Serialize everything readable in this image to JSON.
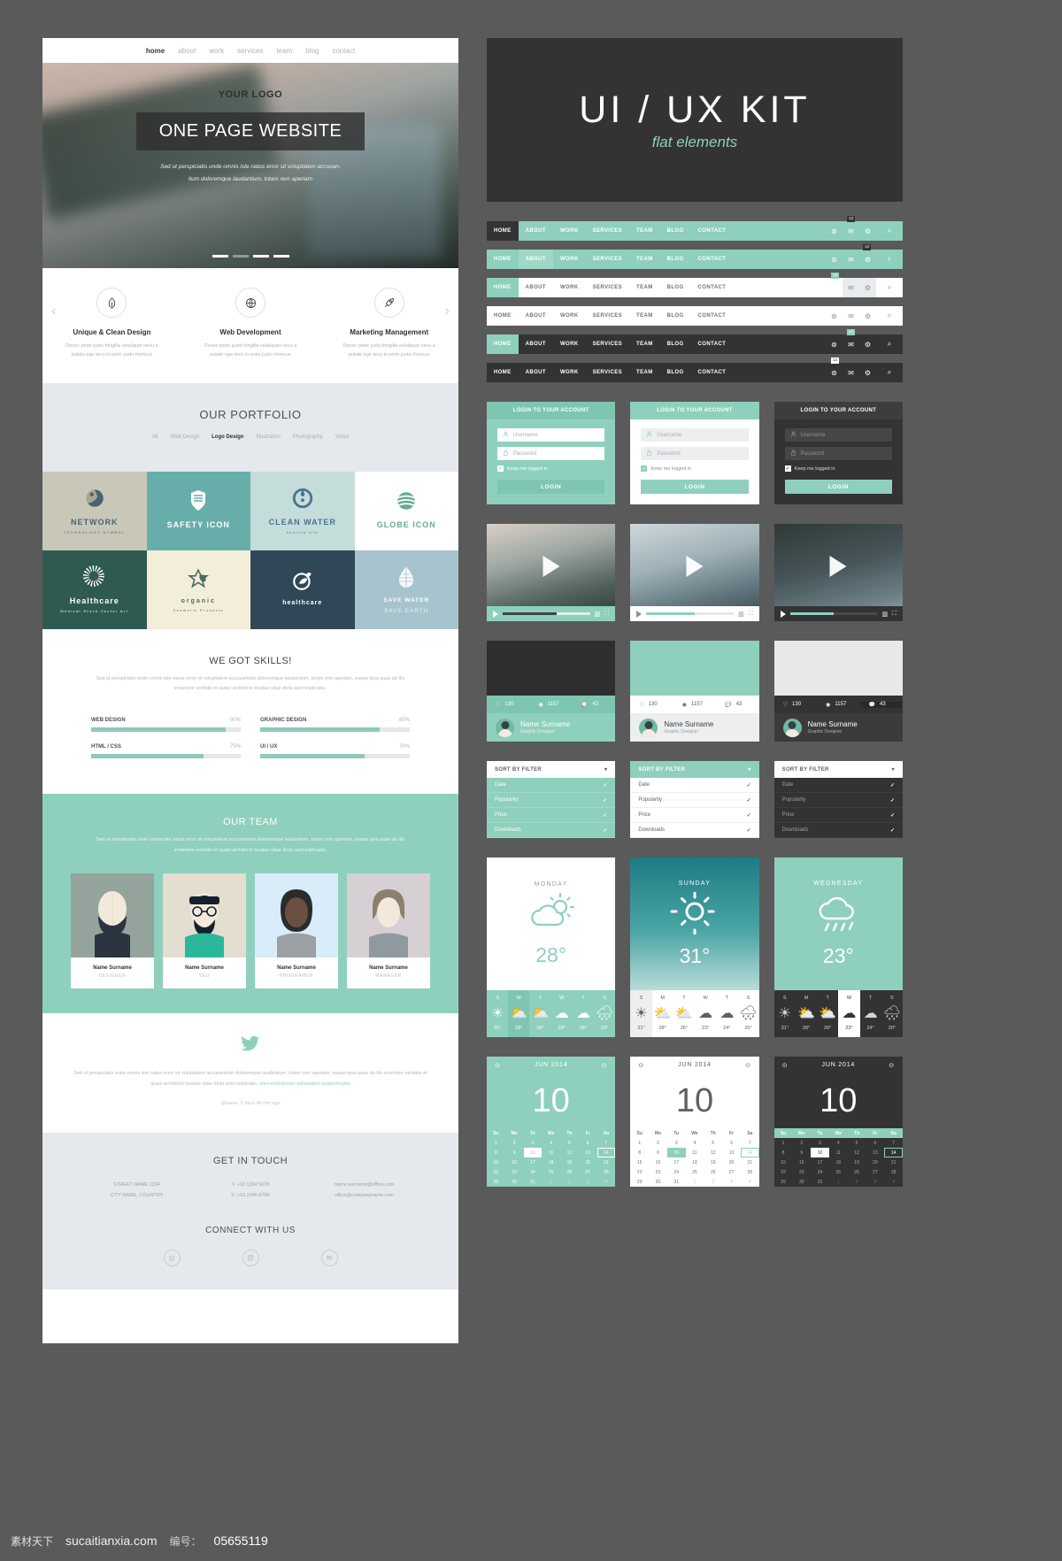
{
  "website": {
    "nav": [
      {
        "label": "home",
        "active": true
      },
      {
        "label": "about",
        "active": false
      },
      {
        "label": "work",
        "active": false
      },
      {
        "label": "services",
        "active": false
      },
      {
        "label": "team",
        "active": false
      },
      {
        "label": "blog",
        "active": false
      },
      {
        "label": "contact",
        "active": false
      }
    ],
    "hero": {
      "logo": "YOUR LOGO",
      "banner": "ONE PAGE WEBSITE",
      "sub_line1": "Sed ut perspiciatis unde omnis iste natus error sit voluptatem accusan-",
      "sub_line2": "tium doloremque laudantium, totam rem aperiam"
    },
    "services": [
      {
        "title": "Unique & Clean Design",
        "desc": "Donec pede justo fringilla velaliquet nevu a putate ege arcu in enim justo rhoncus",
        "icon": "pen-nib-icon"
      },
      {
        "title": "Web Development",
        "desc": "Donec pede justo fringilla velaliquet nevu a putate ege arcu in enim justo rhoncus",
        "icon": "globe-icon"
      },
      {
        "title": "Marketing Management",
        "desc": "Donec pede justo fringilla velaliquet nevu a putate ege arcu in enim justo rhoncus",
        "icon": "rocket-icon"
      }
    ],
    "portfolio": {
      "title": "OUR PORTFOLIO",
      "filters": [
        {
          "label": "All",
          "active": false
        },
        {
          "label": "Web Design",
          "active": false
        },
        {
          "label": "Logo Design",
          "active": true
        },
        {
          "label": "Illustration",
          "active": false
        },
        {
          "label": "Photography",
          "active": false
        },
        {
          "label": "Video",
          "active": false
        }
      ],
      "tiles": [
        {
          "t1": "NETWORK",
          "t2": "TECHNOLOGY SYMBOL",
          "bg": "#c9c8b8",
          "fg": "#4b6274",
          "icon": "people-globe-icon"
        },
        {
          "t1": "SAFETY ICON",
          "t2": "",
          "bg": "#67aeab",
          "fg": "#ffffff",
          "icon": "shield-icon"
        },
        {
          "t1": "CLEAN WATER",
          "t2": "healthy life",
          "bg": "#c5ddda",
          "fg": "#497392",
          "icon": "waterdrop-circle-icon"
        },
        {
          "t1": "GLOBE ICON",
          "t2": "",
          "bg": "#ffffff",
          "fg": "#67aa94",
          "icon": "striped-globe-icon"
        },
        {
          "t1": "Healthcare",
          "t2": "Medical Stock Vector Art",
          "bg": "#2f5a51",
          "fg": "#ffffff",
          "icon": "dotted-sphere-icon"
        },
        {
          "t1": "organic",
          "t2": "Cosmetic Products",
          "bg": "#f2eeda",
          "fg": "#4d6b5f",
          "icon": "flower-leaf-icon"
        },
        {
          "t1": "healthcare",
          "t2": "",
          "bg": "#2f4757",
          "fg": "#ffffff",
          "icon": "leaf-circle-icon"
        },
        {
          "t1": "SAVE WATER",
          "t2": "SAVE EARTH",
          "bg": "#a6c3ce",
          "fg": "#ffffff",
          "icon": "drop-grid-icon"
        }
      ]
    },
    "skills": {
      "title": "WE GOT SKILLS!",
      "desc": "Sed ut perspiciatis unde omnis iste natus error sit voluptatem accusantiam doloremque laudantium, totam rem aperiam, eaque ipsa quae ab illo inventore veritatis et quasi architecto beatae vitae dicta sunt explicabo.",
      "bars": [
        {
          "label": "WEB DESIGN",
          "value": "90%",
          "pct": 90
        },
        {
          "label": "GRAPHIC DESIGN",
          "value": "80%",
          "pct": 80
        },
        {
          "label": "HTML / CSS",
          "value": "75%",
          "pct": 75
        },
        {
          "label": "UI / UX",
          "value": "70%",
          "pct": 70
        }
      ]
    },
    "team": {
      "title": "OUR TEAM",
      "desc": "Sed ut perspiciatis unde omnis iste natus error sit voluptatem accusantiam doloremque laudantium, totam rem aperiam, eaque ipsa quae ab illo inventore veritatis et quasi architecto beatae vitae dicta sunt explicabo.",
      "members": [
        {
          "name": "Name Surname",
          "role": "DESIGNER"
        },
        {
          "name": "Name Surname",
          "role": "SEO"
        },
        {
          "name": "Name Surname",
          "role": "PROGRAMER"
        },
        {
          "name": "Name Surname",
          "role": "MANAGER"
        }
      ]
    },
    "tweet": {
      "icon": "twitter-bird-icon",
      "text": "Sed ut perspiciatis unde omnis iste natus error sit voluptatem accusantium doloremque laudantium, totam rem aperiam, eaque ipsa quae ab illo inventore veritatis et quasi architecto beatae vitae dicta sunt explicabo. ",
      "link": "emo-enim/ipsam voluptatem quia/voluptas",
      "meta": "@name, 5 days 48 min ago"
    },
    "contact": {
      "title": "GET IN TOUCH",
      "col1_line1": "STREET NAME 1234",
      "col1_line2": "CITY NAME, COUNTRY",
      "col2_line1": "T: +10 1234 5678",
      "col2_line2": "F: +10 2345 6789",
      "col3_line1": "name.surname@office.com",
      "col3_line2": "office@companyname.com",
      "connect_title": "CONNECT WITH US",
      "socials": [
        "social-circle-icon",
        "at-sign-icon",
        "envelope-icon"
      ]
    }
  },
  "kit": {
    "title": "UI / UX KIT",
    "subtitle": "flat elements",
    "navbars": [
      {
        "style": "teal",
        "active_index": 0,
        "badge": "13",
        "icons": [
          "at-icon",
          "envelope-icon",
          "gear-icon"
        ],
        "search": "search-icon"
      },
      {
        "style": "teal2",
        "active_index": 1,
        "badge": "13",
        "icons": [
          "at-icon",
          "envelope-icon",
          "gear-icon"
        ],
        "search": "search-icon"
      },
      {
        "style": "light",
        "active_index": 0,
        "badge": "13",
        "icons": [
          "envelope-icon",
          "gear-icon"
        ],
        "search": "search-icon"
      },
      {
        "style": "light2",
        "active_index": null,
        "badge": "",
        "icons": [
          "at-icon",
          "envelope-icon",
          "gear-icon"
        ],
        "search": "search-icon"
      },
      {
        "style": "dark",
        "active_index": 0,
        "badge": "13",
        "icons": [
          "at-icon",
          "envelope-icon",
          "gear-icon"
        ],
        "search": "search-icon"
      },
      {
        "style": "dark2",
        "active_index": null,
        "badge": "13",
        "icons": [
          "at-icon",
          "envelope-icon",
          "gear-icon"
        ],
        "search": "search-icon"
      }
    ],
    "nav_items": [
      "HOME",
      "ABOUT",
      "WORK",
      "SERVICES",
      "TEAM",
      "BLOG",
      "CONTACT"
    ],
    "login": {
      "heading": "LOGIN TO YOUR ACCOUNT",
      "username_placeholder": "Username",
      "password_placeholder": "Password",
      "remember_label": "Keep me logged in",
      "button_label": "LOGIN",
      "user_icon": "user-icon",
      "lock_icon": "lock-icon",
      "check_icon": "check-icon"
    },
    "players": [
      {
        "variant": "v1",
        "play_icon": "play-icon",
        "eq_icon": "equalizer-icon",
        "expand_icon": "expand-icon"
      },
      {
        "variant": "v2",
        "play_icon": "play-icon",
        "eq_icon": "equalizer-icon",
        "expand_icon": "expand-icon"
      },
      {
        "variant": "v3",
        "play_icon": "play-icon",
        "eq_icon": "equalizer-icon",
        "expand_icon": "expand-icon"
      }
    ],
    "social_cards": [
      {
        "variant": "v1",
        "likes": "130",
        "views": "1157",
        "comments": "43",
        "name": "Name Surname",
        "role": "Graphic Designer"
      },
      {
        "variant": "v2",
        "likes": "130",
        "views": "1157",
        "comments": "43",
        "name": "Name Surname",
        "role": "Graphic Designer"
      },
      {
        "variant": "v3",
        "likes": "130",
        "views": "1157",
        "comments": "43",
        "name": "Name Surname",
        "role": "Graphic Designer"
      }
    ],
    "filters": {
      "heading": "SORT BY FILTER",
      "chevron_icon": "chevron-down-icon",
      "check_icon": "check-icon",
      "items": [
        "Date",
        "Popularity",
        "Price",
        "Downloads"
      ]
    },
    "weather": [
      {
        "variant": "v1",
        "day": "MONDAY",
        "temp": "28°",
        "icon": "sun-cloud-icon",
        "week": [
          {
            "d": "S",
            "t": "31°",
            "icon": "sun-icon",
            "sel": false
          },
          {
            "d": "M",
            "t": "28°",
            "icon": "sun-cloud-icon",
            "sel": true
          },
          {
            "d": "T",
            "t": "26°",
            "icon": "sun-cloud-icon",
            "sel": false
          },
          {
            "d": "W",
            "t": "23°",
            "icon": "cloud-icon",
            "sel": false
          },
          {
            "d": "T",
            "t": "24°",
            "icon": "clouds-icon",
            "sel": false
          },
          {
            "d": "S",
            "t": "20°",
            "icon": "rain-icon",
            "sel": false
          }
        ]
      },
      {
        "variant": "v2",
        "day": "SUNDAY",
        "temp": "31°",
        "icon": "sun-icon",
        "week": [
          {
            "d": "S",
            "t": "31°",
            "icon": "sun-icon",
            "sel": true
          },
          {
            "d": "M",
            "t": "28°",
            "icon": "sun-cloud-icon",
            "sel": false
          },
          {
            "d": "T",
            "t": "26°",
            "icon": "sun-cloud-icon",
            "sel": false
          },
          {
            "d": "W",
            "t": "23°",
            "icon": "cloud-icon",
            "sel": false
          },
          {
            "d": "T",
            "t": "24°",
            "icon": "clouds-icon",
            "sel": false
          },
          {
            "d": "S",
            "t": "20°",
            "icon": "rain-icon",
            "sel": false
          }
        ]
      },
      {
        "variant": "v3",
        "day": "WEDNESDAY",
        "temp": "23°",
        "icon": "rain-icon",
        "week": [
          {
            "d": "S",
            "t": "31°",
            "icon": "sun-icon",
            "sel": false
          },
          {
            "d": "M",
            "t": "28°",
            "icon": "sun-cloud-icon",
            "sel": false
          },
          {
            "d": "T",
            "t": "26°",
            "icon": "sun-cloud-icon",
            "sel": false
          },
          {
            "d": "W",
            "t": "23°",
            "icon": "cloud-icon",
            "sel": true
          },
          {
            "d": "T",
            "t": "24°",
            "icon": "clouds-icon",
            "sel": false
          },
          {
            "d": "S",
            "t": "20°",
            "icon": "rain-icon",
            "sel": false
          }
        ]
      }
    ],
    "calendar": {
      "month": "JUN 2014",
      "big_day": "10",
      "prev_icon": "prev-circle-icon",
      "next_icon": "next-circle-icon",
      "weekdays": [
        "Su",
        "Mo",
        "Tu",
        "We",
        "Th",
        "Fr",
        "Sa"
      ],
      "weeks": [
        [
          {
            "n": "1"
          },
          {
            "n": "2"
          },
          {
            "n": "3"
          },
          {
            "n": "4"
          },
          {
            "n": "5"
          },
          {
            "n": "6"
          },
          {
            "n": "7"
          }
        ],
        [
          {
            "n": "8"
          },
          {
            "n": "9"
          },
          {
            "n": "10",
            "sel": true
          },
          {
            "n": "11"
          },
          {
            "n": "12"
          },
          {
            "n": "13"
          },
          {
            "n": "14",
            "box": true
          }
        ],
        [
          {
            "n": "15"
          },
          {
            "n": "16"
          },
          {
            "n": "17"
          },
          {
            "n": "18"
          },
          {
            "n": "19"
          },
          {
            "n": "20"
          },
          {
            "n": "21"
          }
        ],
        [
          {
            "n": "22"
          },
          {
            "n": "23"
          },
          {
            "n": "24"
          },
          {
            "n": "25"
          },
          {
            "n": "26"
          },
          {
            "n": "27"
          },
          {
            "n": "28"
          }
        ],
        [
          {
            "n": "29"
          },
          {
            "n": "30"
          },
          {
            "n": "31"
          },
          {
            "n": "1",
            "mut": true
          },
          {
            "n": "2",
            "mut": true
          },
          {
            "n": "3",
            "mut": true
          },
          {
            "n": "4",
            "mut": true
          }
        ]
      ],
      "variants": [
        "v1",
        "v2",
        "v3"
      ]
    }
  },
  "watermark": {
    "brand": "素材天下",
    "url": "sucaitianxia.com",
    "num_label": "编号：",
    "number": "05655119"
  },
  "colors": {
    "teal": "#8ed0bd",
    "dark": "#333333",
    "page_bg": "#5a5a5a",
    "light_grey": "#e5e8ec"
  }
}
